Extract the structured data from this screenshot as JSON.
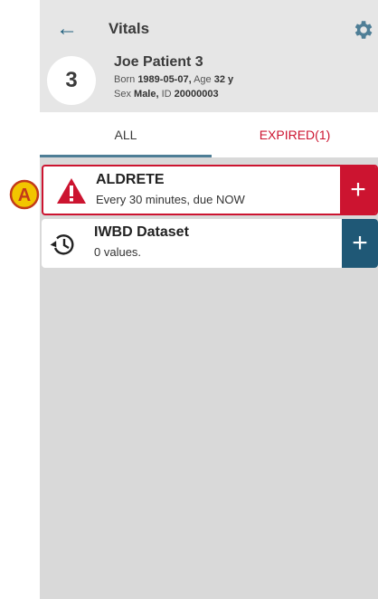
{
  "header": {
    "title": "Vitals",
    "back_icon": "arrow-left-icon",
    "settings_icon": "gear-icon"
  },
  "patient": {
    "number": "3",
    "name": "Joe Patient 3",
    "born_label": "Born",
    "born_value": "1989-05-07,",
    "age_label": "Age",
    "age_value": "32 y",
    "sex_label": "Sex",
    "sex_value": "Male,",
    "id_label": "ID",
    "id_value": "20000003"
  },
  "tabs": [
    {
      "label": "ALL",
      "active": true
    },
    {
      "label": "EXPIRED(1)",
      "active": false
    }
  ],
  "cards": [
    {
      "title": "ALDRETE",
      "subtitle": "Every 30 minutes, due NOW",
      "icon": "warning-icon",
      "action": "+"
    },
    {
      "title": "IWBD Dataset",
      "subtitle": "0 values.",
      "icon": "history-icon",
      "action": "+"
    }
  ],
  "callout": {
    "label": "A"
  },
  "colors": {
    "accent_red": "#cc1430",
    "accent_blue": "#1f5876",
    "callout_yellow": "#f2c500"
  }
}
